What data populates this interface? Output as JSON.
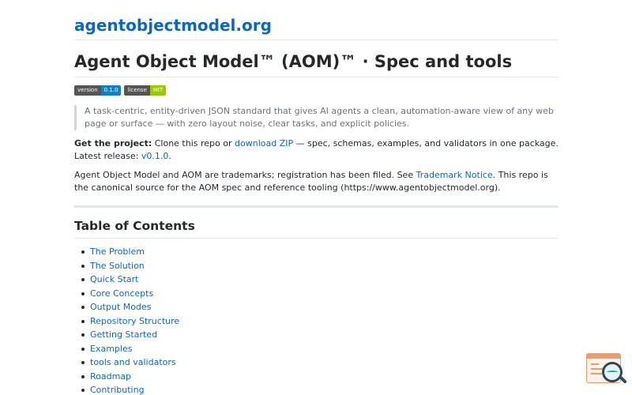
{
  "header": {
    "site_title": "agentobjectmodel.org"
  },
  "page": {
    "title": "Agent Object Model™ (AOM)™ · Spec and tools"
  },
  "badges": [
    {
      "key": "version",
      "value": "0.1.0",
      "color": "#1281c4"
    },
    {
      "key": "license",
      "value": "MIT",
      "color": "#97ca00"
    }
  ],
  "intro": {
    "quote": "A task-centric, entity-driven JSON standard that gives AI agents a clean, automation-aware view of any web page or surface — with zero layout noise, clear tasks, and explicit policies.",
    "get_project_label": "Get the project:",
    "get_project_pre": " Clone this repo or ",
    "download_link": "download ZIP",
    "get_project_mid": " — spec, schemas, examples, and validators in one package. Latest release: ",
    "release_link": "v0.1.0",
    "get_project_end": ".",
    "trademark_pre": "Agent Object Model and AOM are trademarks; registration has been filed. See ",
    "trademark_link": "Trademark Notice",
    "trademark_post": ". This repo is the canonical source for the AOM spec and reference tooling (https://www.agentobjectmodel.org)."
  },
  "toc": {
    "title": "Table of Contents",
    "items": [
      "The Problem",
      "The Solution",
      "Quick Start",
      "Core Concepts",
      "Output Modes",
      "Repository Structure",
      "Getting Started",
      "Examples",
      "tools and validators",
      "Roadmap",
      "Contributing"
    ]
  },
  "widget": {
    "icon": "document-search-icon"
  },
  "colors": {
    "link": "#0a67c3",
    "text": "#24292e",
    "muted": "#6a737d",
    "widget_accent": "#f29a6b"
  }
}
